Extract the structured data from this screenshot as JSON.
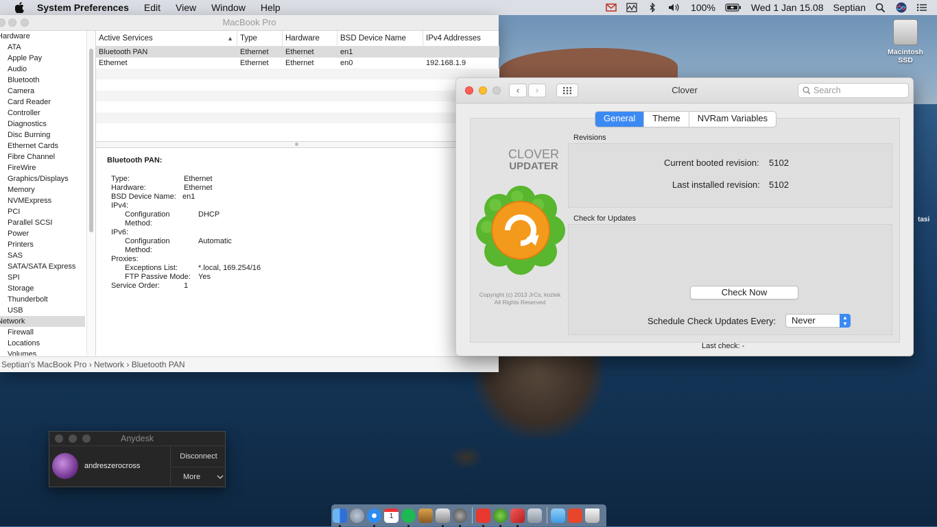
{
  "menubar": {
    "app_name": "System Preferences",
    "menus": [
      "Edit",
      "View",
      "Window",
      "Help"
    ],
    "battery": "100%",
    "clock": "Wed 1 Jan  15.08",
    "user": "Septian"
  },
  "desktop": {
    "drive_label": "Macintosh SSD",
    "partial_label": "tasi"
  },
  "sysinfo": {
    "title": "MacBook Pro",
    "sidebar": {
      "categories": [
        {
          "label": "Hardware",
          "items": [
            "ATA",
            "Apple Pay",
            "Audio",
            "Bluetooth",
            "Camera",
            "Card Reader",
            "Controller",
            "Diagnostics",
            "Disc Burning",
            "Ethernet Cards",
            "Fibre Channel",
            "FireWire",
            "Graphics/Displays",
            "Memory",
            "NVMExpress",
            "PCI",
            "Parallel SCSI",
            "Power",
            "Printers",
            "SAS",
            "SATA/SATA Express",
            "SPI",
            "Storage",
            "Thunderbolt",
            "USB"
          ]
        },
        {
          "label": "Network",
          "items": [
            "Firewall",
            "Locations",
            "Volumes"
          ]
        }
      ]
    },
    "table": {
      "columns": [
        "Active Services",
        "Type",
        "Hardware",
        "BSD Device Name",
        "IPv4 Addresses"
      ],
      "rows": [
        [
          "Bluetooth PAN",
          "Ethernet",
          "Ethernet",
          "en1",
          ""
        ],
        [
          "Ethernet",
          "Ethernet",
          "Ethernet",
          "en0",
          "192.168.1.9"
        ]
      ]
    },
    "detail": {
      "heading": "Bluetooth PAN:",
      "type_k": "Type:",
      "type_v": "Ethernet",
      "hw_k": "Hardware:",
      "hw_v": "Ethernet",
      "bsd_k": "BSD Device Name:",
      "bsd_v": "en1",
      "ipv4_k": "IPv4:",
      "cfg4_k": "Configuration Method:",
      "cfg4_v": "DHCP",
      "ipv6_k": "IPv6:",
      "cfg6_k": "Configuration Method:",
      "cfg6_v": "Automatic",
      "proxies_k": "Proxies:",
      "exc_k": "Exceptions List:",
      "exc_v": "*.local, 169.254/16",
      "ftp_k": "FTP Passive Mode:",
      "ftp_v": "Yes",
      "order_k": "Service Order:",
      "order_v": "1"
    },
    "pathbar": "Septian's MacBook Pro › Network › Bluetooth PAN"
  },
  "clover": {
    "title": "Clover",
    "search_placeholder": "Search",
    "tabs": [
      "General",
      "Theme",
      "NVRam Variables"
    ],
    "logo_line1": "CLOVER",
    "logo_line2": "UPDATER",
    "copyright_line1": "Copyright (c) 2013 JrCs, kozlek",
    "copyright_line2": "All Rights Reserved",
    "revisions_label": "Revisions",
    "current_label": "Current booted revision:",
    "current_value": "5102",
    "installed_label": "Last installed revision:",
    "installed_value": "5102",
    "updates_label": "Check for Updates",
    "check_button": "Check Now",
    "schedule_label": "Schedule Check Updates Every:",
    "schedule_value": "Never",
    "last_check": "Last check: -"
  },
  "anydesk": {
    "title": "Anydesk",
    "user": "andreszerocross",
    "disconnect": "Disconnect",
    "more": "More"
  },
  "dock": {
    "apps": [
      "Finder",
      "Launchpad",
      "Safari",
      "Calendar",
      "Spotify",
      "Archive",
      "System Information",
      "System Preferences",
      "AnyDesk",
      "Clover Configurator",
      "Toolbox",
      "Disk Utility",
      "Downloads",
      "Office",
      "Trash"
    ]
  }
}
